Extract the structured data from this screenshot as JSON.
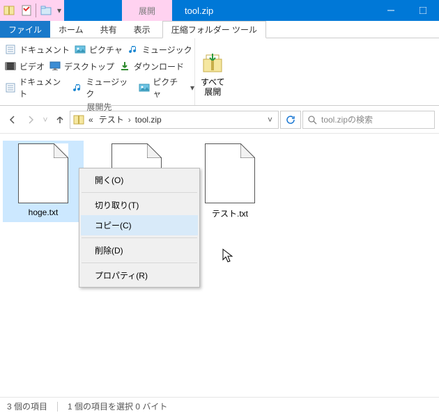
{
  "window": {
    "title": "tool.zip",
    "contextual_tab_label": "展開"
  },
  "tabs": {
    "file": "ファイル",
    "home": "ホーム",
    "share": "共有",
    "view": "表示",
    "compressed": "圧縮フォルダー ツール"
  },
  "ribbon": {
    "dest": {
      "documents1": "ドキュメント",
      "video": "ビデオ",
      "documents2": "ドキュメント",
      "pictures1": "ピクチャ",
      "desktop": "デスクトップ",
      "music": "ミュージック",
      "music2": "ミュージック",
      "downloads": "ダウンロード",
      "pictures2": "ピクチャ",
      "group_label": "展開先"
    },
    "extract": {
      "line1": "すべて",
      "line2": "展開"
    }
  },
  "breadcrumbs": {
    "root_prefix": "«",
    "folder": "テスト",
    "archive": "tool.zip"
  },
  "search": {
    "placeholder": "tool.zipの検索"
  },
  "files": [
    {
      "name": "hoge.txt",
      "selected": true
    },
    {
      "name": ""
    },
    {
      "name": "テスト.txt"
    }
  ],
  "context_menu": {
    "open": "開く(O)",
    "cut": "切り取り(T)",
    "copy": "コピー(C)",
    "delete": "削除(D)",
    "properties": "プロパティ(R)"
  },
  "status": {
    "count": "3 個の項目",
    "selection": "1 個の項目を選択 0 バイト"
  }
}
